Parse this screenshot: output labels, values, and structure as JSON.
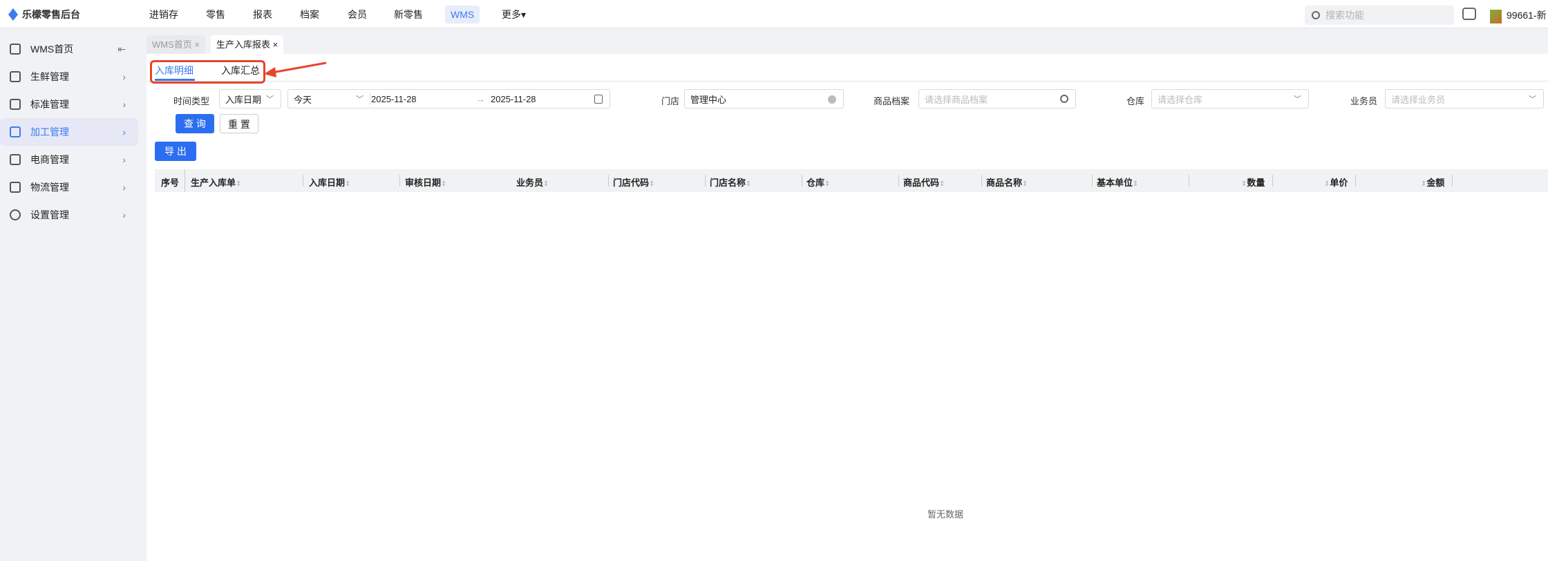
{
  "app": {
    "title": "乐檬零售后台"
  },
  "topnav": {
    "items": [
      "进销存",
      "零售",
      "报表",
      "档案",
      "会员",
      "新零售",
      "WMS",
      "更多▾"
    ],
    "active": "WMS",
    "search_placeholder": "搜索功能",
    "user": "99661-新"
  },
  "sidebar": {
    "items": [
      {
        "label": "WMS首页",
        "icon": "home-icon"
      },
      {
        "label": "生鲜管理",
        "icon": "fresh-bag-icon"
      },
      {
        "label": "标准管理",
        "icon": "copy-icon"
      },
      {
        "label": "加工管理",
        "icon": "process-icon",
        "active": true
      },
      {
        "label": "电商管理",
        "icon": "store-icon"
      },
      {
        "label": "物流管理",
        "icon": "truck-icon"
      },
      {
        "label": "设置管理",
        "icon": "settings-hex-icon"
      }
    ],
    "collapse": "⇤"
  },
  "page_tabs": [
    {
      "label": "WMS首页 ×"
    },
    {
      "label": "生产入库报表 ×",
      "active": true
    }
  ],
  "sub_tabs": [
    "入库明细",
    "入库汇总"
  ],
  "filters": {
    "time_type_label": "时间类型",
    "time_type_value": "入库日期",
    "range_preset": "今天",
    "date_start": "2025-11-28",
    "date_sep": "→",
    "date_end": "2025-11-28",
    "store_label": "门店",
    "store_value": "管理中心",
    "product_label": "商品档案",
    "product_placeholder": "请选择商品档案",
    "warehouse_label": "仓库",
    "warehouse_placeholder": "请选择仓库",
    "salesman_label": "业务员",
    "salesman_placeholder": "请选择业务员"
  },
  "buttons": {
    "query": "查 询",
    "reset": "重 置",
    "export": "导 出"
  },
  "table": {
    "columns": [
      "序号",
      "生产入库单",
      "入库日期",
      "审核日期",
      "业务员",
      "门店代码",
      "门店名称",
      "仓库",
      "商品代码",
      "商品名称",
      "基本单位",
      "数量",
      "单价",
      "金额"
    ],
    "empty": "暂无数据"
  },
  "colors": {
    "accent": "#2b6ff0",
    "annotation": "#e8452c"
  }
}
